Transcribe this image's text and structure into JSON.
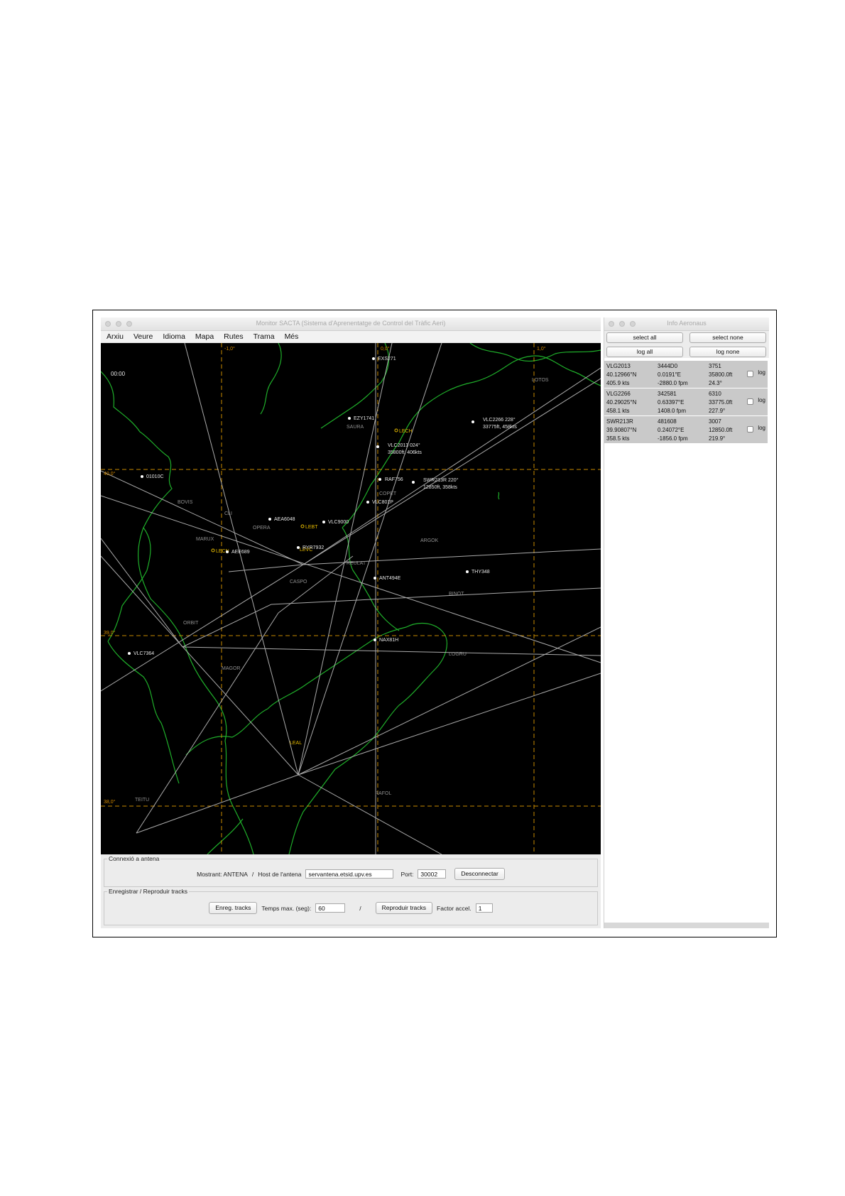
{
  "main_window": {
    "title": "Monitor SACTA (Sistema d'Aprenentatge de Control del Tràfic Aeri)",
    "menu": [
      "Arxiu",
      "Veure",
      "Idioma",
      "Mapa",
      "Rutes",
      "Trama",
      "Més"
    ]
  },
  "map": {
    "clock": "00:00",
    "grid_labels": [
      "-1,0°",
      "0,0°",
      "1,0°",
      "40,0°",
      "39,0°",
      "38,0°"
    ],
    "aircraft": [
      {
        "callsign": "EXS271"
      },
      {
        "callsign": "EZY1741"
      },
      {
        "callsign": "VLC2266 228°",
        "detail": "33775ft, 458kts"
      },
      {
        "callsign": "VLC2013 024°",
        "detail": "35800ft, 406kts"
      },
      {
        "callsign": "01010C"
      },
      {
        "callsign": "RAF756"
      },
      {
        "callsign": "SWR213R 220°",
        "detail": "12850ft, 358kts"
      },
      {
        "callsign": "VLC801P"
      },
      {
        "callsign": "AEA6048"
      },
      {
        "callsign": "VLC9000"
      },
      {
        "callsign": "RYR7932"
      },
      {
        "callsign": "AEE689"
      },
      {
        "callsign": "THY348"
      },
      {
        "callsign": "ANT494E"
      },
      {
        "callsign": "NAX81H"
      },
      {
        "callsign": "VLC7364"
      }
    ],
    "waypoints": [
      "LOTOS",
      "SAURA",
      "COPET",
      "BOVIS",
      "CLI",
      "OPERA",
      "MARUX",
      "REULAT",
      "ARGOK",
      "CASPO",
      "ORBIT",
      "MAGOR",
      "BINOT",
      "LOGRU",
      "RAFOL",
      "TEITU"
    ],
    "airports": [
      "LECH",
      "LEBT",
      "LEVC",
      "LECN",
      "LEAL"
    ]
  },
  "connection": {
    "group_title": "Connexió a antena",
    "showing_label": "Mostrant: ANTENA",
    "separator": "/",
    "host_label": "Host de l'antena",
    "host_value": "servantena.etsid.upv.es",
    "port_label": "Port:",
    "port_value": "30002",
    "disconnect_label": "Desconnectar"
  },
  "tracks": {
    "group_title": "Enregistrar / Reproduir tracks",
    "record_label": "Enreg. tracks",
    "max_time_label": "Temps max. (seg):",
    "max_time_value": "60",
    "separator": "/",
    "play_label": "Reproduir tracks",
    "accel_label": "Factor accel.",
    "accel_value": "1"
  },
  "info_window": {
    "title": "Info Aeronaus",
    "select_all": "select all",
    "select_none": "select none",
    "log_all": "log all",
    "log_none": "log none",
    "log_label": "log",
    "aircraft": [
      {
        "callsign": "VLG2013",
        "icao": "3444D0",
        "squawk": "3751",
        "lat": "40.12966°N",
        "lon": "0.0191°E",
        "alt": "35800.0ft",
        "speed": "405.9 kts",
        "vrate": "-2880.0 fpm",
        "heading": "24.3°"
      },
      {
        "callsign": "VLG2266",
        "icao": "342581",
        "squawk": "6310",
        "lat": "40.29025°N",
        "lon": "0.63397°E",
        "alt": "33775.0ft",
        "speed": "458.1 kts",
        "vrate": "1408.0 fpm",
        "heading": "227.9°"
      },
      {
        "callsign": "SWR213R",
        "icao": "481608",
        "squawk": "3007",
        "lat": "39.90807°N",
        "lon": "0.24072°E",
        "alt": "12850.0ft",
        "speed": "358.5 kts",
        "vrate": "-1856.0 fpm",
        "heading": "219.9°"
      }
    ]
  },
  "colors": {
    "map_background": "#000000",
    "coastline": "#1fae2a",
    "grid": "#c98a00",
    "routes": "#bdbdbd",
    "airport": "#e4b900",
    "info_card": "#c9c9c9"
  }
}
